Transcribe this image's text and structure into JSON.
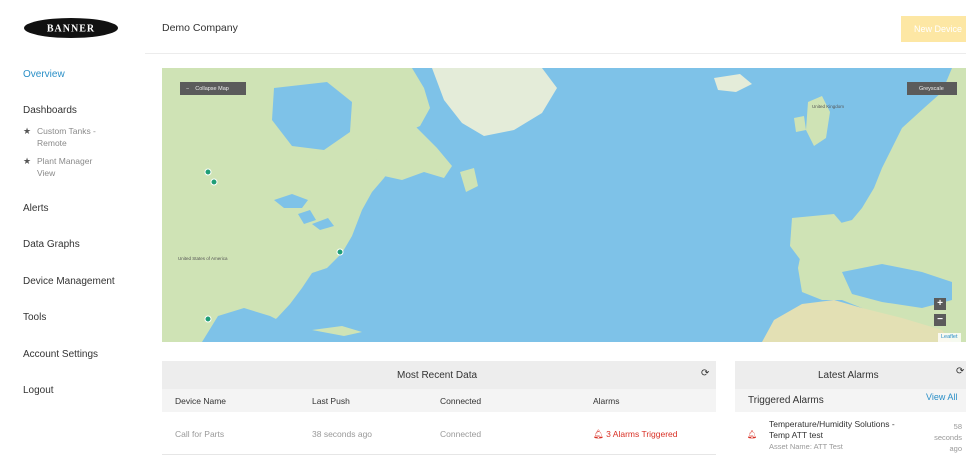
{
  "sidebar": {
    "logo_text": "BANNER",
    "overview": "Overview",
    "dashboards": "Dashboards",
    "dashboard_items": [
      {
        "line1": "Custom Tanks -",
        "line2": "Remote"
      },
      {
        "line1": "Plant Manager",
        "line2": "View"
      }
    ],
    "alerts": "Alerts",
    "data_graphs": "Data Graphs",
    "device_management": "Device Management",
    "tools": "Tools",
    "account_settings": "Account Settings",
    "logout": "Logout"
  },
  "header": {
    "company": "Demo Company",
    "new_device": "New Device"
  },
  "map": {
    "collapse": "Collapse Map",
    "greyscale": "Greyscale",
    "zoom_in": "+",
    "zoom_out": "−",
    "attribution": "Leaflet",
    "labels": {
      "usa": "United States of America",
      "united_kingdom": "United Kingdom"
    },
    "colors": {
      "water": "#7ec2e8",
      "land": "#cfe3b5",
      "marker": "#1f9e77"
    }
  },
  "recent_data": {
    "title": "Most Recent Data",
    "columns": [
      "Device Name",
      "Last Push",
      "Connected",
      "Alarms"
    ],
    "rows": [
      {
        "device": "Call for Parts",
        "last_push": "38 seconds ago",
        "connected": "Connected",
        "alarms": "3 Alarms Triggered"
      }
    ]
  },
  "latest_alarms": {
    "title": "Latest Alarms",
    "subtitle": "Triggered Alarms",
    "view_all": "View All",
    "items": [
      {
        "name_line1": "Temperature/Humidity Solutions -",
        "name_line2": "Temp ATT test",
        "asset": "Asset Name: ATT Test",
        "time_line1": "58",
        "time_line2": "seconds",
        "time_line3": "ago"
      }
    ]
  }
}
